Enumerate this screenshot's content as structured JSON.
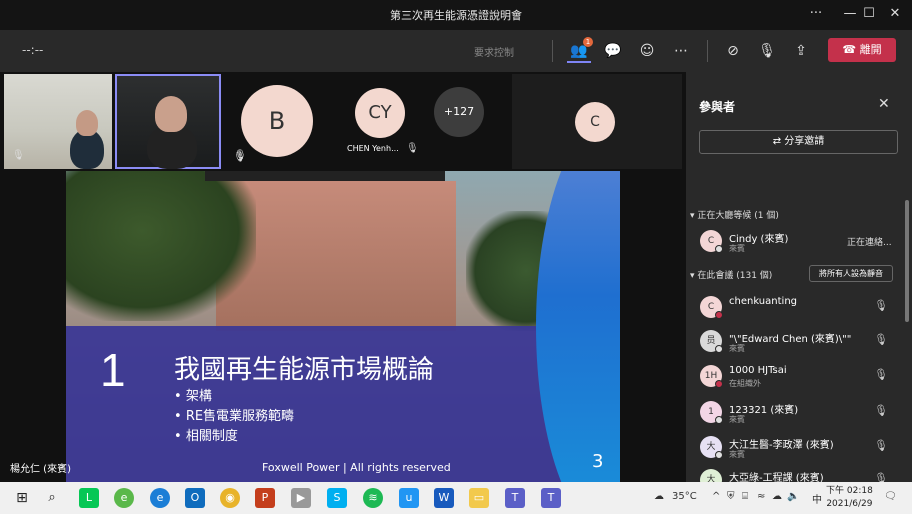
{
  "window": {
    "title": "第三次再生能源憑證說明會",
    "minimize": "—",
    "maximize": "☐",
    "close": "✕"
  },
  "toolbar": {
    "timer": "--:--",
    "request_control": "要求控制",
    "participants_badge": "1",
    "leave_label": "離開"
  },
  "gallery": {
    "tiles": [
      {
        "initials": "B",
        "label": ""
      },
      {
        "initials": "CY",
        "label": "CHEN Yenh..."
      },
      {
        "initials": "+127",
        "label": ""
      },
      {
        "initials": "C",
        "label": ""
      }
    ]
  },
  "slide": {
    "number": "1",
    "title": "我國再生能源市場概論",
    "bullets": [
      "架構",
      "RE售電業服務範疇",
      "相關制度"
    ],
    "footer": "Foxwell Power | All rights reserved",
    "page": "3"
  },
  "presenter_name": "楊允仁 (來賓)",
  "panel": {
    "title": "參與者",
    "share_invite": "分享邀請",
    "lobby_header": "正在大廳等候 (1 個)",
    "in_meeting_header": "在此會議 (131 個)",
    "mute_all": "將所有人設為靜音",
    "lobby": [
      {
        "initial": "C",
        "name": "Cindy (來賓)",
        "sub": "來賓",
        "status": "正在連絡..."
      }
    ],
    "participants": [
      {
        "initial": "C",
        "name": "chenkuanting",
        "sub": "",
        "color": "#f3d6d6",
        "dot": "#c4314b"
      },
      {
        "initial": "员",
        "name": "\"\\\"Edward Chen (來賓)\\\"\"",
        "sub": "來賓",
        "color": "#d9d9d9",
        "dot": "#e0e0e0"
      },
      {
        "initial": "1H",
        "name": "1000 HJTsai",
        "sub": "在組織外",
        "color": "#f3d6d6",
        "dot": "#c4314b"
      },
      {
        "initial": "1",
        "name": "123321 (來賓)",
        "sub": "來賓",
        "color": "#f3d6e6",
        "dot": "#e0e0e0"
      },
      {
        "initial": "大",
        "name": "大江生醫-李政澤 (來賓)",
        "sub": "來賓",
        "color": "#e6e0f3",
        "dot": "#e0e0e0"
      },
      {
        "initial": "大",
        "name": "大亞綠-工程課 (來賓)",
        "sub": "",
        "color": "#e0f0d6",
        "dot": "#e0e0e0"
      }
    ]
  },
  "taskbar": {
    "weather": "35°C",
    "ime": "中",
    "time": "下午 02:18",
    "date": "2021/6/29"
  }
}
